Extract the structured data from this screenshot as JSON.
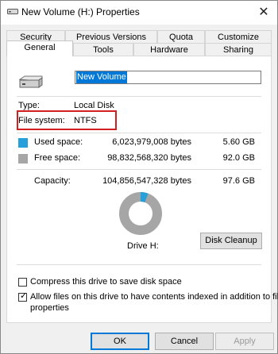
{
  "window": {
    "title": "New Volume (H:) Properties",
    "close_glyph": "✕"
  },
  "tabs": {
    "row1": [
      "Security",
      "Previous Versions",
      "Quota",
      "Customize"
    ],
    "row2": [
      "General",
      "Tools",
      "Hardware",
      "Sharing"
    ]
  },
  "general": {
    "volume_name": "New Volume",
    "type_label": "Type:",
    "type_value": "Local Disk",
    "fs_label": "File system:",
    "fs_value": "NTFS",
    "used_label": "Used space:",
    "used_bytes": "6,023,979,008 bytes",
    "used_gb": "5.60 GB",
    "free_label": "Free space:",
    "free_bytes": "98,832,568,320 bytes",
    "free_gb": "92.0 GB",
    "capacity_label": "Capacity:",
    "capacity_bytes": "104,856,547,328 bytes",
    "capacity_gb": "97.6 GB",
    "drive_label": "Drive H:",
    "disk_cleanup": "Disk Cleanup",
    "compress_label": "Compress this drive to save disk space",
    "compress_checked": false,
    "index_label_line1": "Allow files on this drive to have contents indexed in addition to file",
    "index_label_line2": "properties",
    "index_checked": true,
    "used_fraction": 0.0574,
    "colors": {
      "used": "#26a0da",
      "free": "#a6a6a6"
    }
  },
  "buttons": {
    "ok": "OK",
    "cancel": "Cancel",
    "apply": "Apply"
  }
}
